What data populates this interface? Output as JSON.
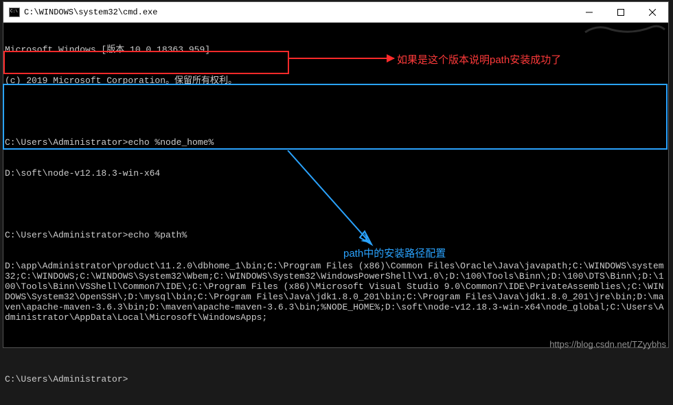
{
  "window": {
    "title": "C:\\WINDOWS\\system32\\cmd.exe"
  },
  "terminal": {
    "header1": "Microsoft Windows [版本 10.0.18363.959]",
    "header2": "(c) 2019 Microsoft Corporation。保留所有权利。",
    "prompt1": "C:\\Users\\Administrator>echo %node_home%",
    "output1": "D:\\soft\\node-v12.18.3-win-x64",
    "prompt2": "C:\\Users\\Administrator>echo %path%",
    "output2": "D:\\app\\Administrator\\product\\11.2.0\\dbhome_1\\bin;C:\\Program Files (x86)\\Common Files\\Oracle\\Java\\javapath;C:\\WINDOWS\\system32;C:\\WINDOWS;C:\\WINDOWS\\System32\\Wbem;C:\\WINDOWS\\System32\\WindowsPowerShell\\v1.0\\;D:\\100\\Tools\\Binn\\;D:\\100\\DTS\\Binn\\;D:\\100\\Tools\\Binn\\VSShell\\Common7\\IDE\\;C:\\Program Files (x86)\\Microsoft Visual Studio 9.0\\Common7\\IDE\\PrivateAssemblies\\;C:\\WINDOWS\\System32\\OpenSSH\\;D:\\mysql\\bin;C:\\Program Files\\Java\\jdk1.8.0_201\\bin;C:\\Program Files\\Java\\jdk1.8.0_201\\jre\\bin;D:\\maven\\apache-maven-3.6.3\\bin;D:\\maven\\apache-maven-3.6.3\\bin;%NODE_HOME%;D:\\soft\\node-v12.18.3-win-x64\\node_global;C:\\Users\\Administrator\\AppData\\Local\\Microsoft\\WindowsApps;",
    "prompt3": "C:\\Users\\Administrator>"
  },
  "annotations": {
    "red_text": "如果是这个版本说明path安装成功了",
    "blue_text": "path中的安装路径配置"
  },
  "watermark": "https://blog.csdn.net/TZyybhs"
}
